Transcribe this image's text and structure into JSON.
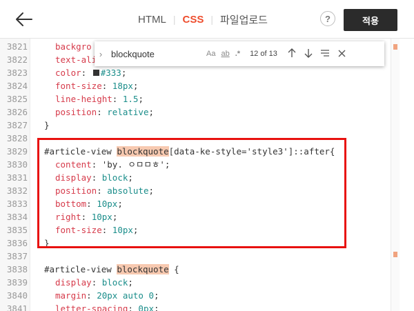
{
  "toolbar": {
    "tabs": [
      {
        "label": "HTML",
        "active": false
      },
      {
        "label": "CSS",
        "active": true
      },
      {
        "label": "파일업로드",
        "active": false
      }
    ],
    "help_label": "?",
    "apply_label": "적용"
  },
  "find": {
    "query": "blockquote",
    "match_case": "Aa",
    "whole_word": "ab",
    "regex": ".*",
    "count": "12 of 13"
  },
  "editor": {
    "lines": [
      {
        "num": "3821",
        "html": "<span class=\"c-prop\">backgro</span>"
      },
      {
        "num": "3822",
        "html": "<span class=\"c-prop\">text-ali</span>"
      },
      {
        "num": "3823",
        "html": "<span class=\"c-prop\">color</span>: <span class=\"swatch\"></span><span class=\"c-val\">#333</span>;"
      },
      {
        "num": "3824",
        "html": "<span class=\"c-prop\">font-size</span>: <span class=\"c-num\">18px</span>;"
      },
      {
        "num": "3825",
        "html": "<span class=\"c-prop\">line-height</span>: <span class=\"c-num\">1.5</span>;"
      },
      {
        "num": "3826",
        "html": "<span class=\"c-prop\">position</span>: <span class=\"c-val\">relative</span>;"
      },
      {
        "num": "3827",
        "html": "}"
      },
      {
        "num": "3828",
        "html": ""
      },
      {
        "num": "3829",
        "html": "#article-view <span class=\"match\">blockquote</span>[data-ke-style='style3']::after{"
      },
      {
        "num": "3830",
        "html": "<span class=\"c-prop\">content</span>: 'by. ㅇㅁㅁㅎ';"
      },
      {
        "num": "3831",
        "html": "<span class=\"c-prop\">display</span>: <span class=\"c-val\">block</span>;"
      },
      {
        "num": "3832",
        "html": "<span class=\"c-prop\">position</span>: <span class=\"c-val\">absolute</span>;"
      },
      {
        "num": "3833",
        "html": "<span class=\"c-prop\">bottom</span>: <span class=\"c-num\">10px</span>;"
      },
      {
        "num": "3834",
        "html": "<span class=\"c-prop\">right</span>: <span class=\"c-num\">10px</span>;"
      },
      {
        "num": "3835",
        "html": "<span class=\"c-prop\">font-size</span>: <span class=\"c-num\">10px</span>;"
      },
      {
        "num": "3836",
        "html": "}"
      },
      {
        "num": "3837",
        "html": ""
      },
      {
        "num": "3838",
        "html": "#article-view <span class=\"match\">blockquote</span> {"
      },
      {
        "num": "3839",
        "html": "<span class=\"c-prop\">display</span>: <span class=\"c-val\">block</span>;"
      },
      {
        "num": "3840",
        "html": "<span class=\"c-prop\">margin</span>: <span class=\"c-num\">20px</span> <span class=\"c-val\">auto</span> <span class=\"c-num\">0</span>;"
      },
      {
        "num": "3841",
        "html": "<span class=\"c-prop\">letter-spacing</span>: <span class=\"c-num\">0px</span>;"
      }
    ]
  }
}
